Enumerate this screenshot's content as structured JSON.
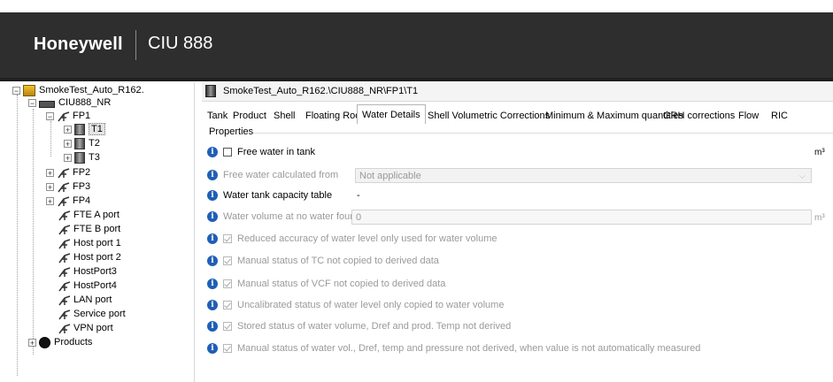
{
  "header": {
    "brand": "Honeywell",
    "product": "CIU 888"
  },
  "tree": {
    "root": "SmokeTest_Auto_R162.",
    "ciu": "CIU888_NR",
    "fp1": "FP1",
    "tanks": [
      "T1",
      "T2",
      "T3"
    ],
    "fps": [
      "FP2",
      "FP3",
      "FP4"
    ],
    "ports": [
      "FTE A port",
      "FTE B port",
      "Host port 1",
      "Host port 2",
      "HostPort3",
      "HostPort4",
      "LAN port",
      "Service port",
      "VPN port"
    ],
    "products": "Products"
  },
  "path": "SmokeTest_Auto_R162.\\CIU888_NR\\FP1\\T1",
  "tabs": [
    "Tank",
    "Product",
    "Shell",
    "Floating Roof",
    "Water Details",
    "Shell Volumetric Corrections",
    "Minimum & Maximum quantities",
    "GRH corrections",
    "Flow",
    "RIC"
  ],
  "active_tab": "Water Details",
  "properties": {
    "group_label": "Properties",
    "free_water_label": "Free water in tank",
    "unit_m3": "m³",
    "calc_from_label": "Free water calculated from",
    "calc_from_value": "Not applicable",
    "capacity_table_label": "Water tank capacity table",
    "capacity_table_value": "-",
    "volume_no_water_label": "Water volume at no water found",
    "volume_no_water_value": "0",
    "checks": [
      "Reduced accuracy of water level only used for water volume",
      "Manual status of TC not copied to derived data",
      "Manual status of VCF not copied to derived data",
      "Uncalibrated status of water level only copied to water volume",
      "Stored status of water volume, Dref and prod. Temp not derived",
      "Manual status of water vol., Dref, temp and pressure not derived, when value is not automatically measured"
    ]
  },
  "colors": {
    "header_bg": "#2e2e2e",
    "info_icon": "#1f5fb5"
  }
}
